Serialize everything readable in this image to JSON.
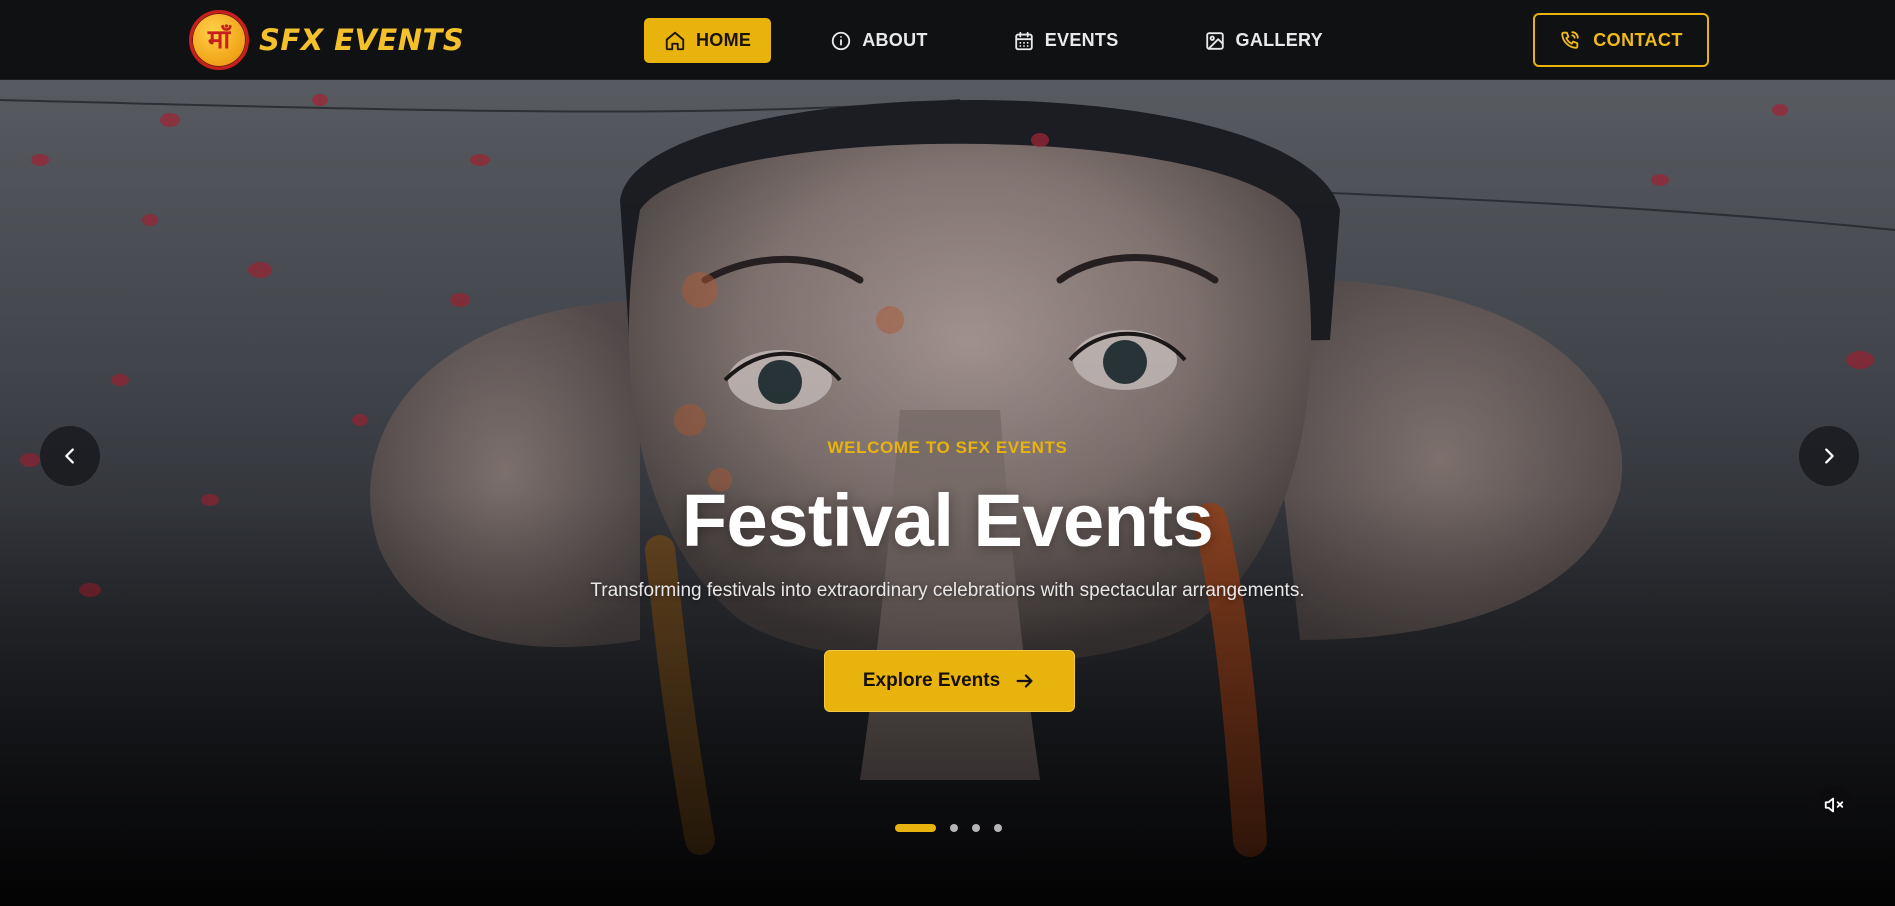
{
  "brand": {
    "logo_text": "माँ",
    "name": "SFX EVENTS"
  },
  "nav": {
    "items": [
      {
        "label": "HOME",
        "icon": "home-icon",
        "active": true
      },
      {
        "label": "ABOUT",
        "icon": "info-icon",
        "active": false
      },
      {
        "label": "EVENTS",
        "icon": "calendar-icon",
        "active": false
      },
      {
        "label": "GALLERY",
        "icon": "image-icon",
        "active": false
      }
    ],
    "contact_label": "CONTACT",
    "contact_icon": "phone-icon"
  },
  "hero": {
    "eyebrow": "WELCOME TO SFX EVENTS",
    "title": "Festival Events",
    "subtitle": "Transforming festivals into extraordinary celebrations with spectacular arrangements.",
    "cta_label": "Explore Events",
    "cta_icon": "arrow-right-icon",
    "prev_icon": "chevron-left-icon",
    "next_icon": "chevron-right-icon",
    "mute_icon": "volume-mute-icon",
    "slides_total": 4,
    "active_slide": 1
  },
  "colors": {
    "accent": "#e8b30c",
    "nav_bg": "#101113",
    "brand_text": "#f4c12c",
    "logo_ring": "#c81e1e"
  }
}
